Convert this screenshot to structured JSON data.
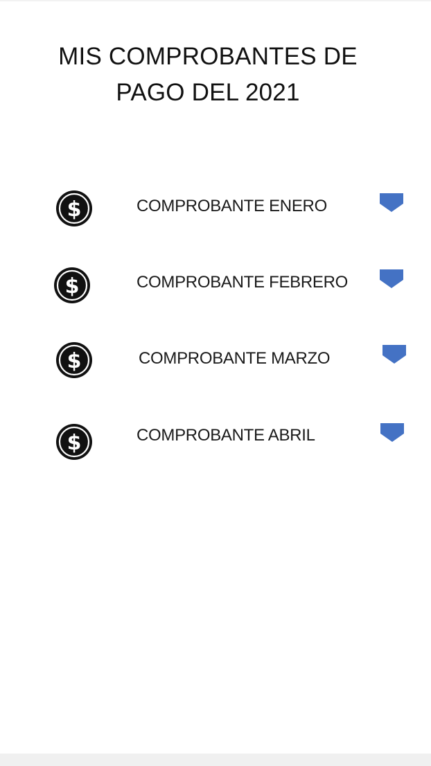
{
  "header": {
    "title_line1": "MIS COMPROBANTES DE",
    "title_line2": "PAGO DEL 2021"
  },
  "items": [
    {
      "label": "COMPROBANTE ENERO",
      "icon": "dollar-coin-icon",
      "action_icon": "chevron-down-icon"
    },
    {
      "label": "COMPROBANTE FEBRERO",
      "icon": "dollar-coin-icon",
      "action_icon": "chevron-down-icon"
    },
    {
      "label": "COMPROBANTE MARZO",
      "icon": "dollar-coin-icon",
      "action_icon": "chevron-down-icon"
    },
    {
      "label": "COMPROBANTE ABRIL",
      "icon": "dollar-coin-icon",
      "action_icon": "chevron-down-icon"
    }
  ],
  "colors": {
    "accent": "#4472c4",
    "coin": "#111111",
    "text": "#1a1a1a"
  }
}
